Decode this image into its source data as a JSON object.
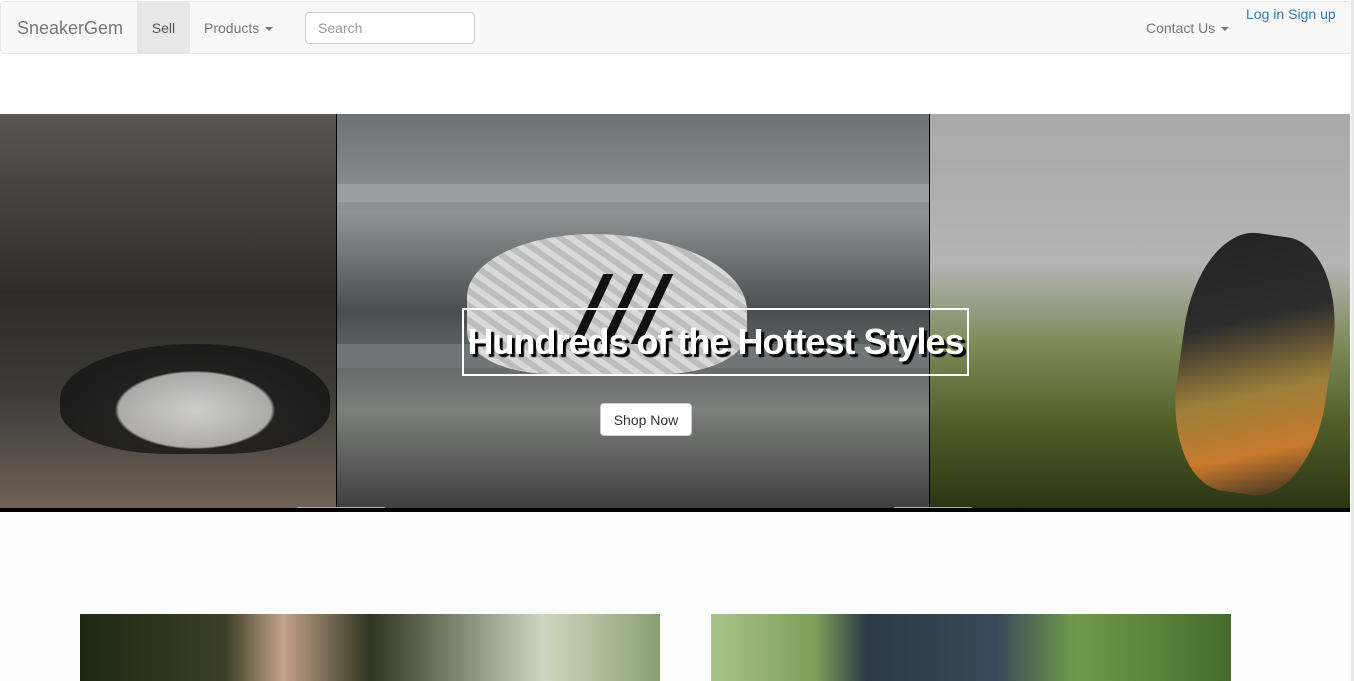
{
  "navbar": {
    "brand": "SneakerGem",
    "sell_label": "Sell",
    "products_label": "Products",
    "search_placeholder": "Search",
    "contact_label": "Contact Us",
    "login_label": "Log in",
    "signup_label": "Sign up"
  },
  "hero": {
    "headline": "Hundreds of the Hottest Styles",
    "cta_label": "Shop Now"
  },
  "colors": {
    "link": "#337ab7",
    "navbar_bg": "#f8f8f8",
    "active_tab_bg": "#e7e7e7"
  }
}
